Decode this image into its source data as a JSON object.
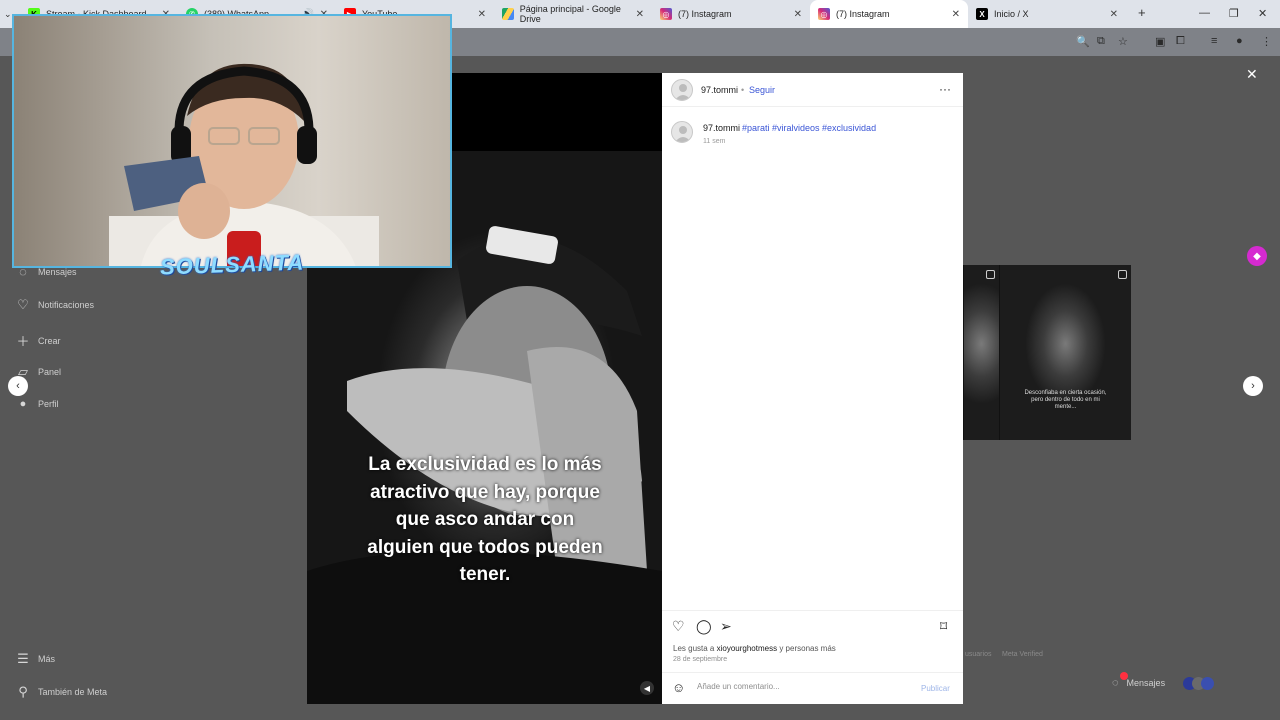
{
  "browser": {
    "tabs": [
      {
        "label": "Stream - Kick Dashboard",
        "icon": "kick-icon",
        "color": "#53fc18"
      },
      {
        "label": "(389) WhatsApp",
        "icon": "whatsapp-icon",
        "color": "#25d366"
      },
      {
        "label": "YouTube",
        "icon": "youtube-icon",
        "color": "#ff0000"
      },
      {
        "label": "Página principal - Google Drive",
        "icon": "google-drive-icon",
        "color": "#1fa463"
      },
      {
        "label": "(7) Instagram",
        "icon": "instagram-icon",
        "color": "#d62976"
      },
      {
        "label": "(7) Instagram",
        "icon": "instagram-icon",
        "color": "#d62976"
      },
      {
        "label": "Inicio / X",
        "icon": "x-icon",
        "color": "#000000"
      }
    ],
    "active_tab_index": 5
  },
  "sidebar": {
    "items": [
      {
        "label": "Mensajes",
        "icon": "messenger-icon"
      },
      {
        "label": "Notificaciones",
        "icon": "heart-icon"
      },
      {
        "label": "Crear",
        "icon": "plus-icon"
      },
      {
        "label": "Panel",
        "icon": "chart-icon"
      },
      {
        "label": "Perfil",
        "icon": "profile-avatar-icon"
      },
      {
        "label": "Más",
        "icon": "menu-icon"
      },
      {
        "label": "También de Meta",
        "icon": "meta-icon"
      }
    ]
  },
  "post": {
    "author": "97.tommi",
    "follow_label": "Seguir",
    "separator": "•",
    "caption_author": "97.tommi",
    "caption_hashtags": "#parati #viralvideos #exclusividad",
    "caption_time": "11 sem",
    "video_caption": "La exclusividad es lo más\natractivo que hay, porque\nque asco andar con\nalguien que todos pueden\ntener.",
    "likes_prefix": "Les gusta a",
    "likes_user": "xioyourghotmess",
    "likes_suffix": "y personas más",
    "date": "28 de septiembre",
    "comment_placeholder": "Añade un comentario...",
    "publish_label": "Publicar"
  },
  "thumbnails": [
    {
      "caption": ""
    },
    {
      "caption": "Desconfiaba en cierta ocasión, pero dentro de todo en mi mente..."
    }
  ],
  "footer": {
    "links": [
      "usuarios",
      "Meta Verified"
    ]
  },
  "messages_pill": {
    "label": "Mensajes"
  },
  "stream_overlay": {
    "logo_text": "SOULSANTA"
  },
  "colors": {
    "instagram_blue": "#3a55d6",
    "webcam_border": "#56b5e0",
    "extension_pink": "#d52ad0"
  }
}
